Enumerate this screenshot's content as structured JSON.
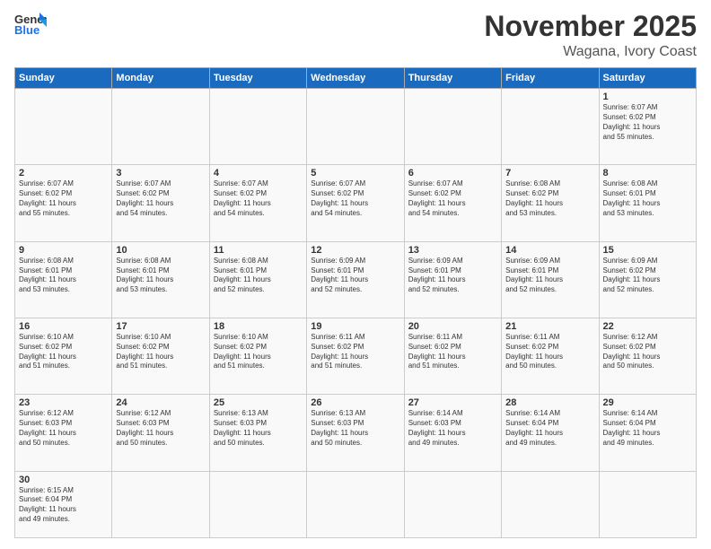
{
  "header": {
    "logo_general": "General",
    "logo_blue": "Blue",
    "title": "November 2025",
    "subtitle": "Wagana, Ivory Coast"
  },
  "weekdays": [
    "Sunday",
    "Monday",
    "Tuesday",
    "Wednesday",
    "Thursday",
    "Friday",
    "Saturday"
  ],
  "weeks": [
    [
      {
        "day": "",
        "info": ""
      },
      {
        "day": "",
        "info": ""
      },
      {
        "day": "",
        "info": ""
      },
      {
        "day": "",
        "info": ""
      },
      {
        "day": "",
        "info": ""
      },
      {
        "day": "",
        "info": ""
      },
      {
        "day": "1",
        "info": "Sunrise: 6:07 AM\nSunset: 6:02 PM\nDaylight: 11 hours\nand 55 minutes."
      }
    ],
    [
      {
        "day": "2",
        "info": "Sunrise: 6:07 AM\nSunset: 6:02 PM\nDaylight: 11 hours\nand 55 minutes."
      },
      {
        "day": "3",
        "info": "Sunrise: 6:07 AM\nSunset: 6:02 PM\nDaylight: 11 hours\nand 54 minutes."
      },
      {
        "day": "4",
        "info": "Sunrise: 6:07 AM\nSunset: 6:02 PM\nDaylight: 11 hours\nand 54 minutes."
      },
      {
        "day": "5",
        "info": "Sunrise: 6:07 AM\nSunset: 6:02 PM\nDaylight: 11 hours\nand 54 minutes."
      },
      {
        "day": "6",
        "info": "Sunrise: 6:07 AM\nSunset: 6:02 PM\nDaylight: 11 hours\nand 54 minutes."
      },
      {
        "day": "7",
        "info": "Sunrise: 6:08 AM\nSunset: 6:02 PM\nDaylight: 11 hours\nand 53 minutes."
      },
      {
        "day": "8",
        "info": "Sunrise: 6:08 AM\nSunset: 6:01 PM\nDaylight: 11 hours\nand 53 minutes."
      }
    ],
    [
      {
        "day": "9",
        "info": "Sunrise: 6:08 AM\nSunset: 6:01 PM\nDaylight: 11 hours\nand 53 minutes."
      },
      {
        "day": "10",
        "info": "Sunrise: 6:08 AM\nSunset: 6:01 PM\nDaylight: 11 hours\nand 53 minutes."
      },
      {
        "day": "11",
        "info": "Sunrise: 6:08 AM\nSunset: 6:01 PM\nDaylight: 11 hours\nand 52 minutes."
      },
      {
        "day": "12",
        "info": "Sunrise: 6:09 AM\nSunset: 6:01 PM\nDaylight: 11 hours\nand 52 minutes."
      },
      {
        "day": "13",
        "info": "Sunrise: 6:09 AM\nSunset: 6:01 PM\nDaylight: 11 hours\nand 52 minutes."
      },
      {
        "day": "14",
        "info": "Sunrise: 6:09 AM\nSunset: 6:01 PM\nDaylight: 11 hours\nand 52 minutes."
      },
      {
        "day": "15",
        "info": "Sunrise: 6:09 AM\nSunset: 6:02 PM\nDaylight: 11 hours\nand 52 minutes."
      }
    ],
    [
      {
        "day": "16",
        "info": "Sunrise: 6:10 AM\nSunset: 6:02 PM\nDaylight: 11 hours\nand 51 minutes."
      },
      {
        "day": "17",
        "info": "Sunrise: 6:10 AM\nSunset: 6:02 PM\nDaylight: 11 hours\nand 51 minutes."
      },
      {
        "day": "18",
        "info": "Sunrise: 6:10 AM\nSunset: 6:02 PM\nDaylight: 11 hours\nand 51 minutes."
      },
      {
        "day": "19",
        "info": "Sunrise: 6:11 AM\nSunset: 6:02 PM\nDaylight: 11 hours\nand 51 minutes."
      },
      {
        "day": "20",
        "info": "Sunrise: 6:11 AM\nSunset: 6:02 PM\nDaylight: 11 hours\nand 51 minutes."
      },
      {
        "day": "21",
        "info": "Sunrise: 6:11 AM\nSunset: 6:02 PM\nDaylight: 11 hours\nand 50 minutes."
      },
      {
        "day": "22",
        "info": "Sunrise: 6:12 AM\nSunset: 6:02 PM\nDaylight: 11 hours\nand 50 minutes."
      }
    ],
    [
      {
        "day": "23",
        "info": "Sunrise: 6:12 AM\nSunset: 6:03 PM\nDaylight: 11 hours\nand 50 minutes."
      },
      {
        "day": "24",
        "info": "Sunrise: 6:12 AM\nSunset: 6:03 PM\nDaylight: 11 hours\nand 50 minutes."
      },
      {
        "day": "25",
        "info": "Sunrise: 6:13 AM\nSunset: 6:03 PM\nDaylight: 11 hours\nand 50 minutes."
      },
      {
        "day": "26",
        "info": "Sunrise: 6:13 AM\nSunset: 6:03 PM\nDaylight: 11 hours\nand 50 minutes."
      },
      {
        "day": "27",
        "info": "Sunrise: 6:14 AM\nSunset: 6:03 PM\nDaylight: 11 hours\nand 49 minutes."
      },
      {
        "day": "28",
        "info": "Sunrise: 6:14 AM\nSunset: 6:04 PM\nDaylight: 11 hours\nand 49 minutes."
      },
      {
        "day": "29",
        "info": "Sunrise: 6:14 AM\nSunset: 6:04 PM\nDaylight: 11 hours\nand 49 minutes."
      }
    ],
    [
      {
        "day": "30",
        "info": "Sunrise: 6:15 AM\nSunset: 6:04 PM\nDaylight: 11 hours\nand 49 minutes."
      },
      {
        "day": "",
        "info": ""
      },
      {
        "day": "",
        "info": ""
      },
      {
        "day": "",
        "info": ""
      },
      {
        "day": "",
        "info": ""
      },
      {
        "day": "",
        "info": ""
      },
      {
        "day": "",
        "info": ""
      }
    ]
  ]
}
